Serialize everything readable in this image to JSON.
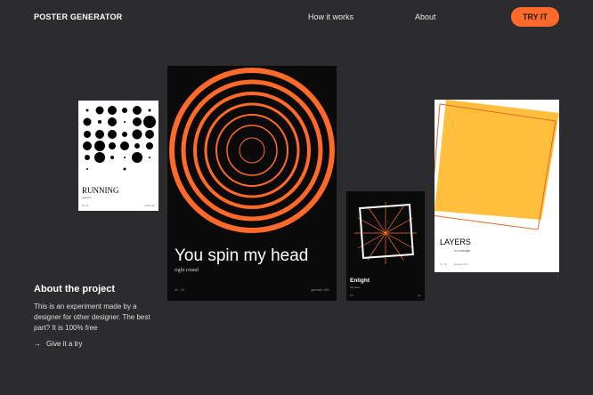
{
  "nav": {
    "logo": "POSTER GENERATOR",
    "links": [
      "How it works",
      "About"
    ],
    "cta": "TRY IT"
  },
  "posters": {
    "running": {
      "title": "RUNNING",
      "subtitle": "practice",
      "footer_left": "01 / 10",
      "footer_right": "poster gen"
    },
    "spin": {
      "title": "You spin my head",
      "subtitle": "right round",
      "footer_left": "01 · 10",
      "footer_right": "generat / 001"
    },
    "enlight": {
      "title": "Enlight",
      "subtitle": "the idea",
      "footer_left": "001",
      "footer_right": "gen"
    },
    "layers": {
      "title": "LAYERS",
      "subtitle": "In coverage",
      "footer_left": "01 · 10",
      "footer_right": "generat / 001"
    }
  },
  "about": {
    "title": "About the project",
    "body": "This is an experiment made by a designer for other designer. The best part? It is 100% free",
    "link": "Give it a try"
  },
  "colors": {
    "accent": "#ff6a2b",
    "background": "#2c2c2e",
    "poster_dark": "#0a0a0a",
    "layers_yellow": "#ffbe3c"
  },
  "icons": {
    "link_arrow": "arrow-right-icon"
  }
}
